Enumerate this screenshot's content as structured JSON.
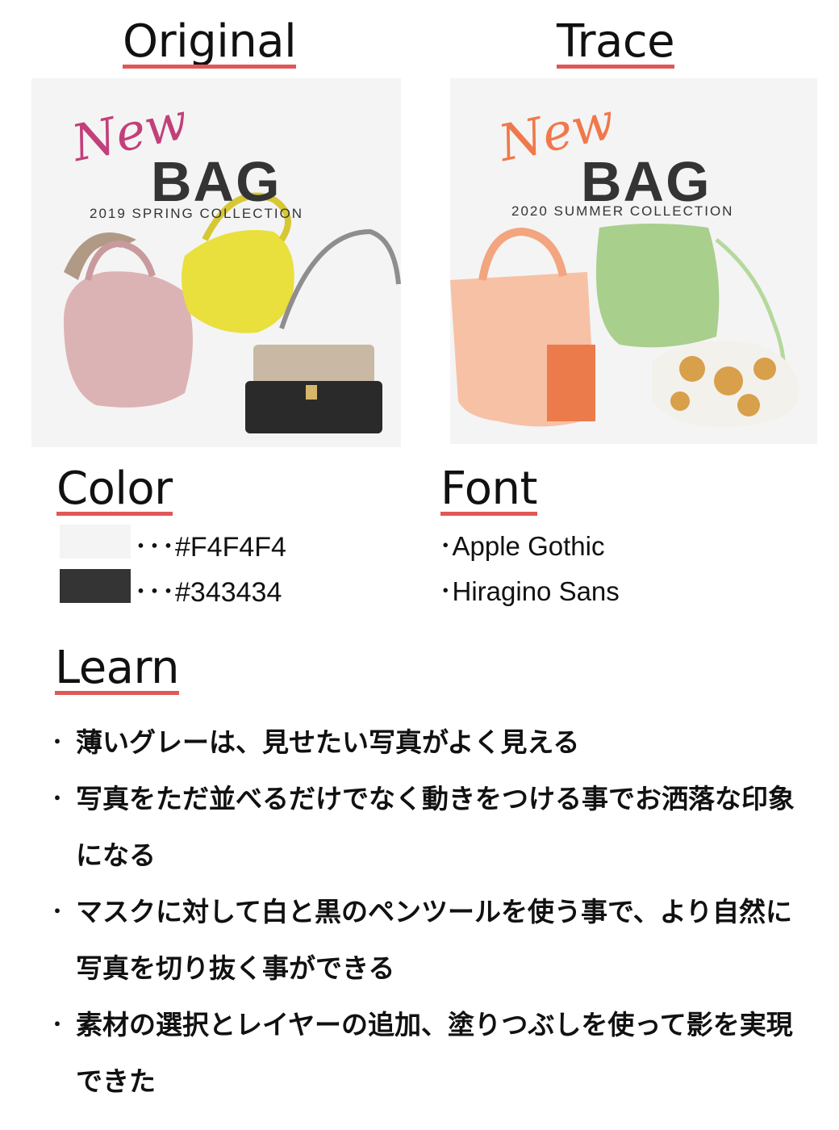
{
  "headings": {
    "original": "Original",
    "trace": "Trace",
    "color": "Color",
    "font": "Font",
    "learn": "Learn"
  },
  "original_banner": {
    "script": "New",
    "title": "BAG",
    "subtitle": "2019 SPRING COLLECTION",
    "script_color": "#c2407a",
    "background": "#f4f4f4"
  },
  "trace_banner": {
    "script": "New",
    "title": "BAG",
    "subtitle": "2020 SUMMER COLLECTION",
    "script_color": "#f0784a",
    "background": "#f4f4f4"
  },
  "colors": [
    {
      "swatch": "#F4F4F4",
      "label": "･･･#F4F4F4"
    },
    {
      "swatch": "#343434",
      "label": "･･･#343434"
    }
  ],
  "fonts": [
    {
      "label": "･Apple Gothic"
    },
    {
      "label": "･Hiragino Sans"
    }
  ],
  "learn": [
    {
      "bullet": "･",
      "text": "薄いグレーは、見せたい写真がよく見える"
    },
    {
      "bullet": "･",
      "text": "写真をただ並べるだけでなく動きをつける事でお洒落な印象になる"
    },
    {
      "bullet": "･",
      "text": "マスクに対して白と黒のペンツールを使う事で、より自然に写真を切り抜く事ができる"
    },
    {
      "bullet": "･",
      "text": "素材の選択とレイヤーの追加、塗りつぶしを使って影を実現できた"
    }
  ],
  "accent_underline": "#e05757"
}
